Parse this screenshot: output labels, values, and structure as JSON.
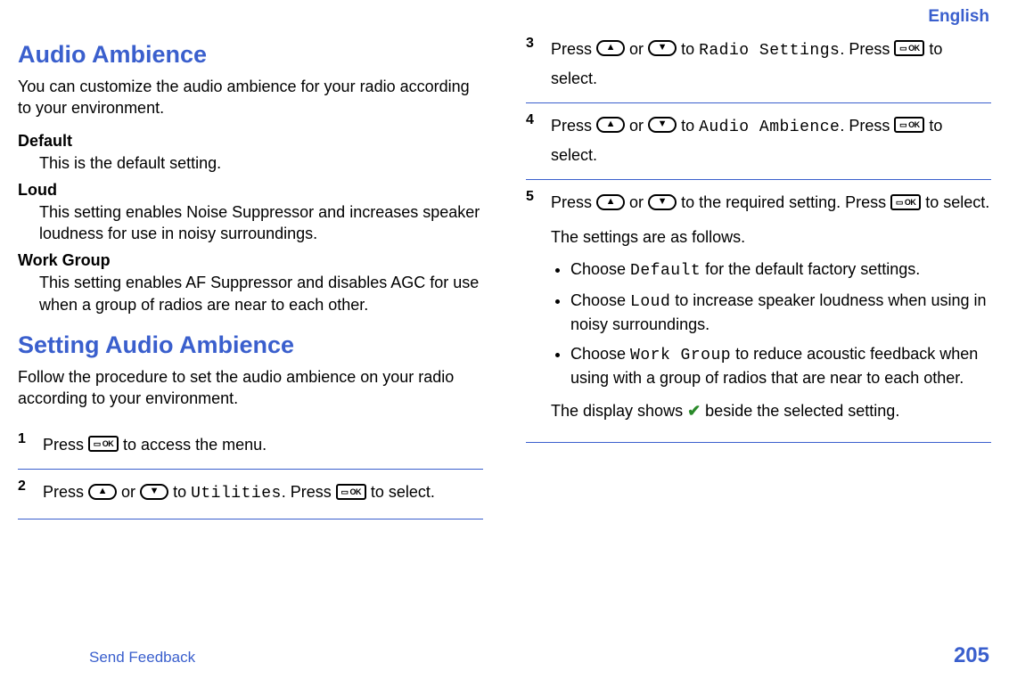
{
  "header": {
    "lang": "English"
  },
  "col1": {
    "h1": "Audio Ambience",
    "p1": "You can customize the audio ambience for your radio according to your environment.",
    "defs": [
      {
        "term": "Default",
        "desc": "This is the default setting."
      },
      {
        "term": "Loud",
        "desc": "This setting enables Noise Suppressor and increases speaker loudness for use in noisy surroundings."
      },
      {
        "term": "Work Group",
        "desc": "This setting enables AF Suppressor and disables AGC for use when a group of radios are near to each other."
      }
    ],
    "h2": "Setting Audio Ambience",
    "p2": "Follow the procedure to set the audio ambience on your radio according to your environment.",
    "step1": {
      "num": "1",
      "a": "Press ",
      "b": " to access the menu."
    },
    "step2": {
      "num": "2",
      "a": "Press ",
      "b": " or ",
      "c": " to ",
      "util": "Utilities",
      "d": ". Press ",
      "e": " to select."
    }
  },
  "col2": {
    "step3": {
      "num": "3",
      "a": "Press ",
      "b": " or ",
      "c": " to ",
      "rs": "Radio Settings",
      "d": ". Press ",
      "e": " to select."
    },
    "step4": {
      "num": "4",
      "a": "Press ",
      "b": " or ",
      "c": " to ",
      "aa": "Audio Ambience",
      "d": ". Press ",
      "e": " to select."
    },
    "step5": {
      "num": "5",
      "a": "Press ",
      "b": " or ",
      "c": " to the required setting. Press ",
      "d": " to select.",
      "intro": "The settings are as follows.",
      "b1a": "Choose ",
      "b1m": "Default",
      "b1b": " for the default factory settings.",
      "b2a": "Choose ",
      "b2m": "Loud",
      "b2b": " to increase speaker loudness when using in noisy surroundings.",
      "b3a": "Choose ",
      "b3m": "Work Group",
      "b3b": " to reduce acoustic feedback when using with a group of radios that are near to each other.",
      "outa": "The display shows ",
      "outb": " beside the selected setting."
    }
  },
  "footer": {
    "feedback": "Send Feedback",
    "page": "205"
  }
}
